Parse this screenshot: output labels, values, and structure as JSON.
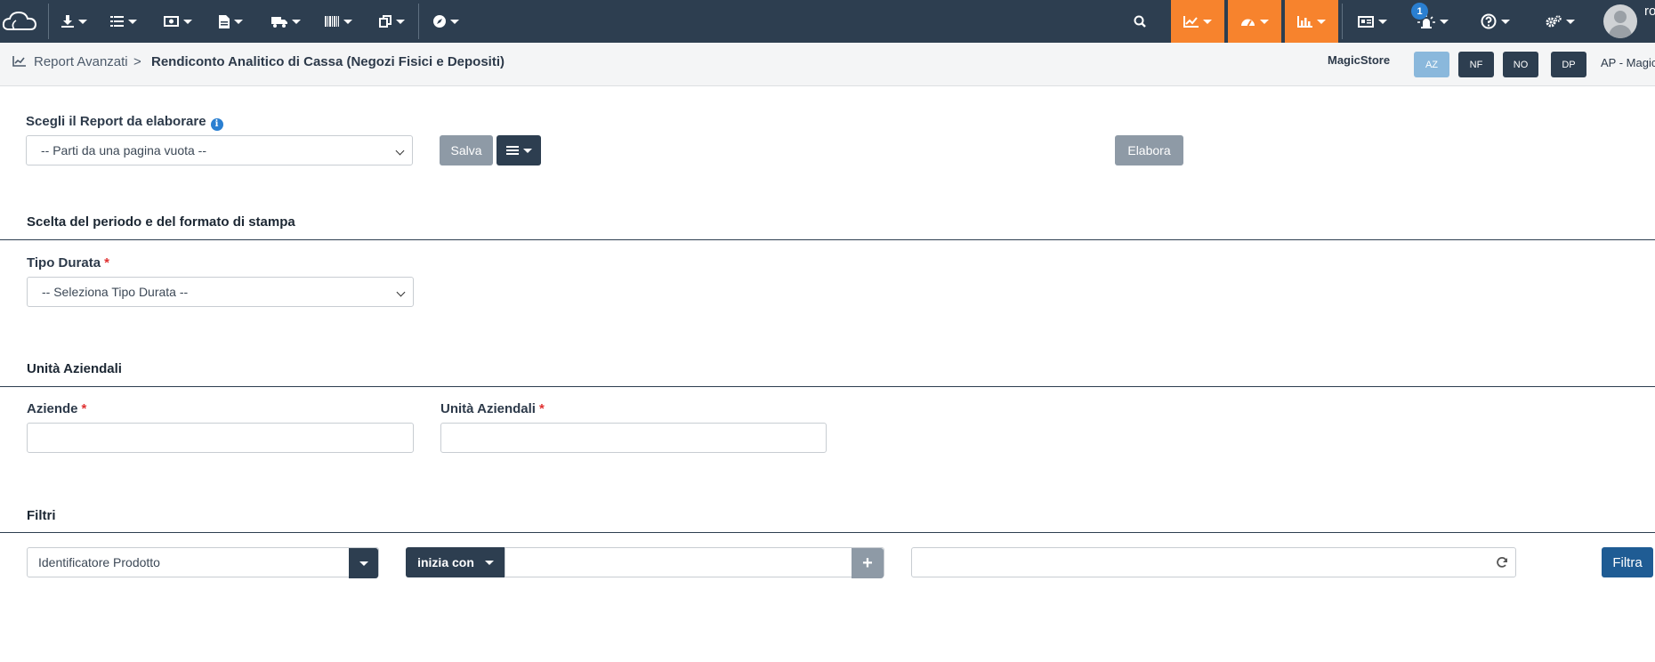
{
  "topbar": {
    "icons": [
      "cloud-logo-icon",
      "download-icon",
      "list-icon",
      "money-icon",
      "document-icon",
      "truck-icon",
      "barcode-icon",
      "copy-icon",
      "compass-icon",
      "search-icon",
      "line-chart-icon",
      "dashboard-icon",
      "bar-chart-icon",
      "id-card-icon",
      "alarm-icon",
      "help-icon",
      "cogs-icon"
    ],
    "notification_count": "1",
    "user_initials": "ro",
    "orange_color": "#f7832d",
    "navbar_color": "#2d3e50"
  },
  "breadcrumb": {
    "parent": "Report Avanzati",
    "separator": ">",
    "current": "Rendiconto Analitico di Cassa (Negozi Fisici e Depositi)"
  },
  "store": {
    "name": "MagicStore",
    "pills": [
      "AZ",
      "NF",
      "NO",
      "DP"
    ],
    "active_pill": "AZ",
    "company_code": "AP - Magic"
  },
  "report": {
    "label": "Scegli il Report da elaborare",
    "selected": "-- Parti da una pagina vuota --",
    "save_label": "Salva",
    "process_label": "Elabora"
  },
  "period_section": {
    "title": "Scelta del periodo e del formato di stampa",
    "duration_label": "Tipo Durata",
    "duration_selected": "-- Seleziona Tipo Durata --",
    "required_mark": "*"
  },
  "units_section": {
    "title": "Unità Aziendali",
    "companies_label": "Aziende",
    "units_label": "Unità Aziendali",
    "companies_value": "",
    "units_value": ""
  },
  "filters_section": {
    "title": "Filtri",
    "field_value": "Identificatore Prodotto",
    "operator_label": "inizia con",
    "text_value": "",
    "plus_label": "+",
    "filter_label": "Filtra"
  }
}
